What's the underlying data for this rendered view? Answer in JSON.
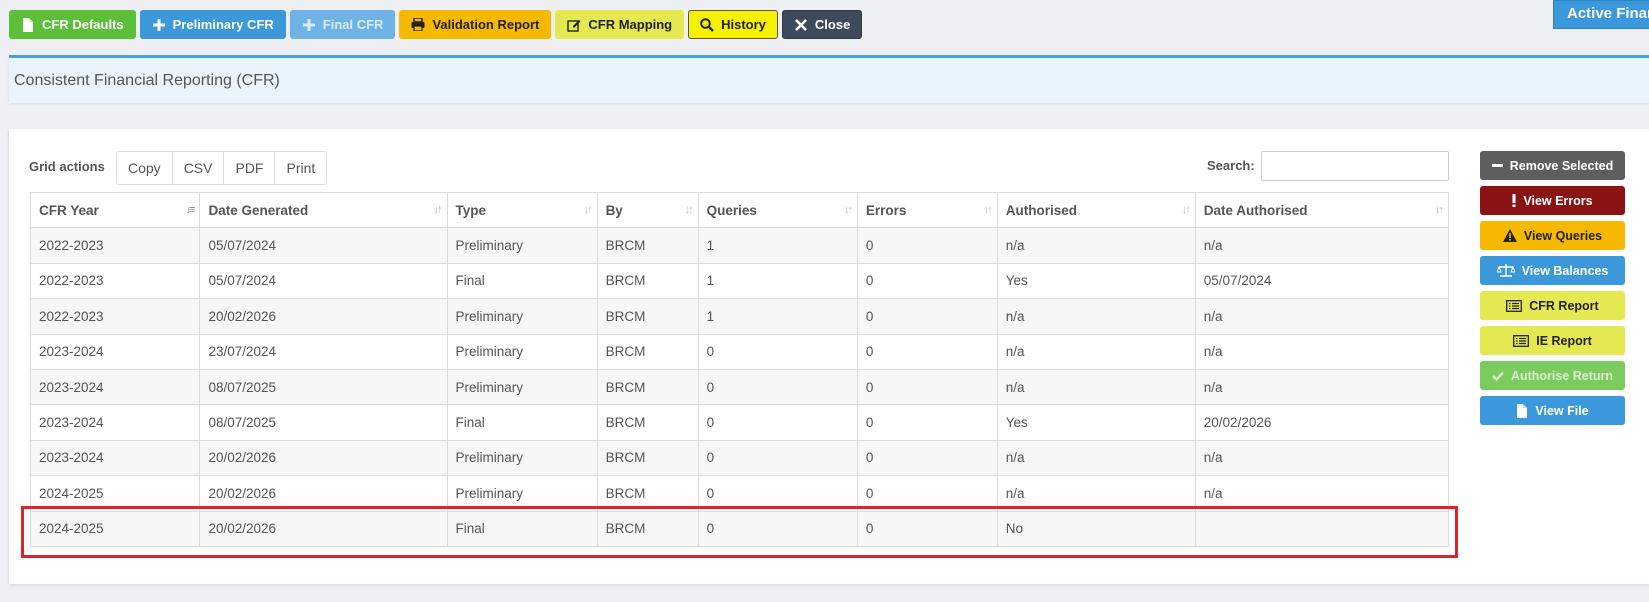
{
  "toolbar": {
    "buttons": [
      {
        "label": "CFR Defaults",
        "icon": "file-icon"
      },
      {
        "label": "Preliminary CFR",
        "icon": "plus-icon"
      },
      {
        "label": "Final CFR",
        "icon": "plus-icon"
      },
      {
        "label": "Validation Report",
        "icon": "print-icon"
      },
      {
        "label": "CFR Mapping",
        "icon": "edit-icon"
      },
      {
        "label": "History",
        "icon": "search-icon"
      },
      {
        "label": "Close",
        "icon": "close-icon"
      }
    ]
  },
  "active_finance": "Active Finance",
  "page_title": "Consistent Financial Reporting (CFR)",
  "grid_actions": {
    "label": "Grid actions",
    "buttons": [
      "Copy",
      "CSV",
      "PDF",
      "Print"
    ]
  },
  "search": {
    "label": "Search:",
    "value": ""
  },
  "table": {
    "columns": [
      "CFR Year",
      "Date Generated",
      "Type",
      "By",
      "Queries",
      "Errors",
      "Authorised",
      "Date Authorised"
    ],
    "rows": [
      [
        "2022-2023",
        "05/07/2024",
        "Preliminary",
        "BRCM",
        "1",
        "0",
        "n/a",
        "n/a"
      ],
      [
        "2022-2023",
        "05/07/2024",
        "Final",
        "BRCM",
        "1",
        "0",
        "Yes",
        "05/07/2024"
      ],
      [
        "2022-2023",
        "20/02/2026",
        "Preliminary",
        "BRCM",
        "1",
        "0",
        "n/a",
        "n/a"
      ],
      [
        "2023-2024",
        "23/07/2024",
        "Preliminary",
        "BRCM",
        "0",
        "0",
        "n/a",
        "n/a"
      ],
      [
        "2023-2024",
        "08/07/2025",
        "Preliminary",
        "BRCM",
        "0",
        "0",
        "n/a",
        "n/a"
      ],
      [
        "2023-2024",
        "08/07/2025",
        "Final",
        "BRCM",
        "0",
        "0",
        "Yes",
        "20/02/2026"
      ],
      [
        "2023-2024",
        "20/02/2026",
        "Preliminary",
        "BRCM",
        "0",
        "0",
        "n/a",
        "n/a"
      ],
      [
        "2024-2025",
        "20/02/2026",
        "Preliminary",
        "BRCM",
        "0",
        "0",
        "n/a",
        "n/a"
      ],
      [
        "2024-2025",
        "20/02/2026",
        "Final",
        "BRCM",
        "0",
        "0",
        "No",
        ""
      ]
    ]
  },
  "side_buttons": [
    {
      "label": "Remove Selected",
      "icon": "minus-icon"
    },
    {
      "label": "View Errors",
      "icon": "exclamation-icon"
    },
    {
      "label": "View Queries",
      "icon": "warning-icon"
    },
    {
      "label": "View Balances",
      "icon": "balance-scale-icon"
    },
    {
      "label": "CFR Report",
      "icon": "list-icon"
    },
    {
      "label": "IE Report",
      "icon": "list-icon"
    },
    {
      "label": "Authorise Return",
      "icon": "check-icon"
    },
    {
      "label": "View File",
      "icon": "file-icon"
    }
  ]
}
